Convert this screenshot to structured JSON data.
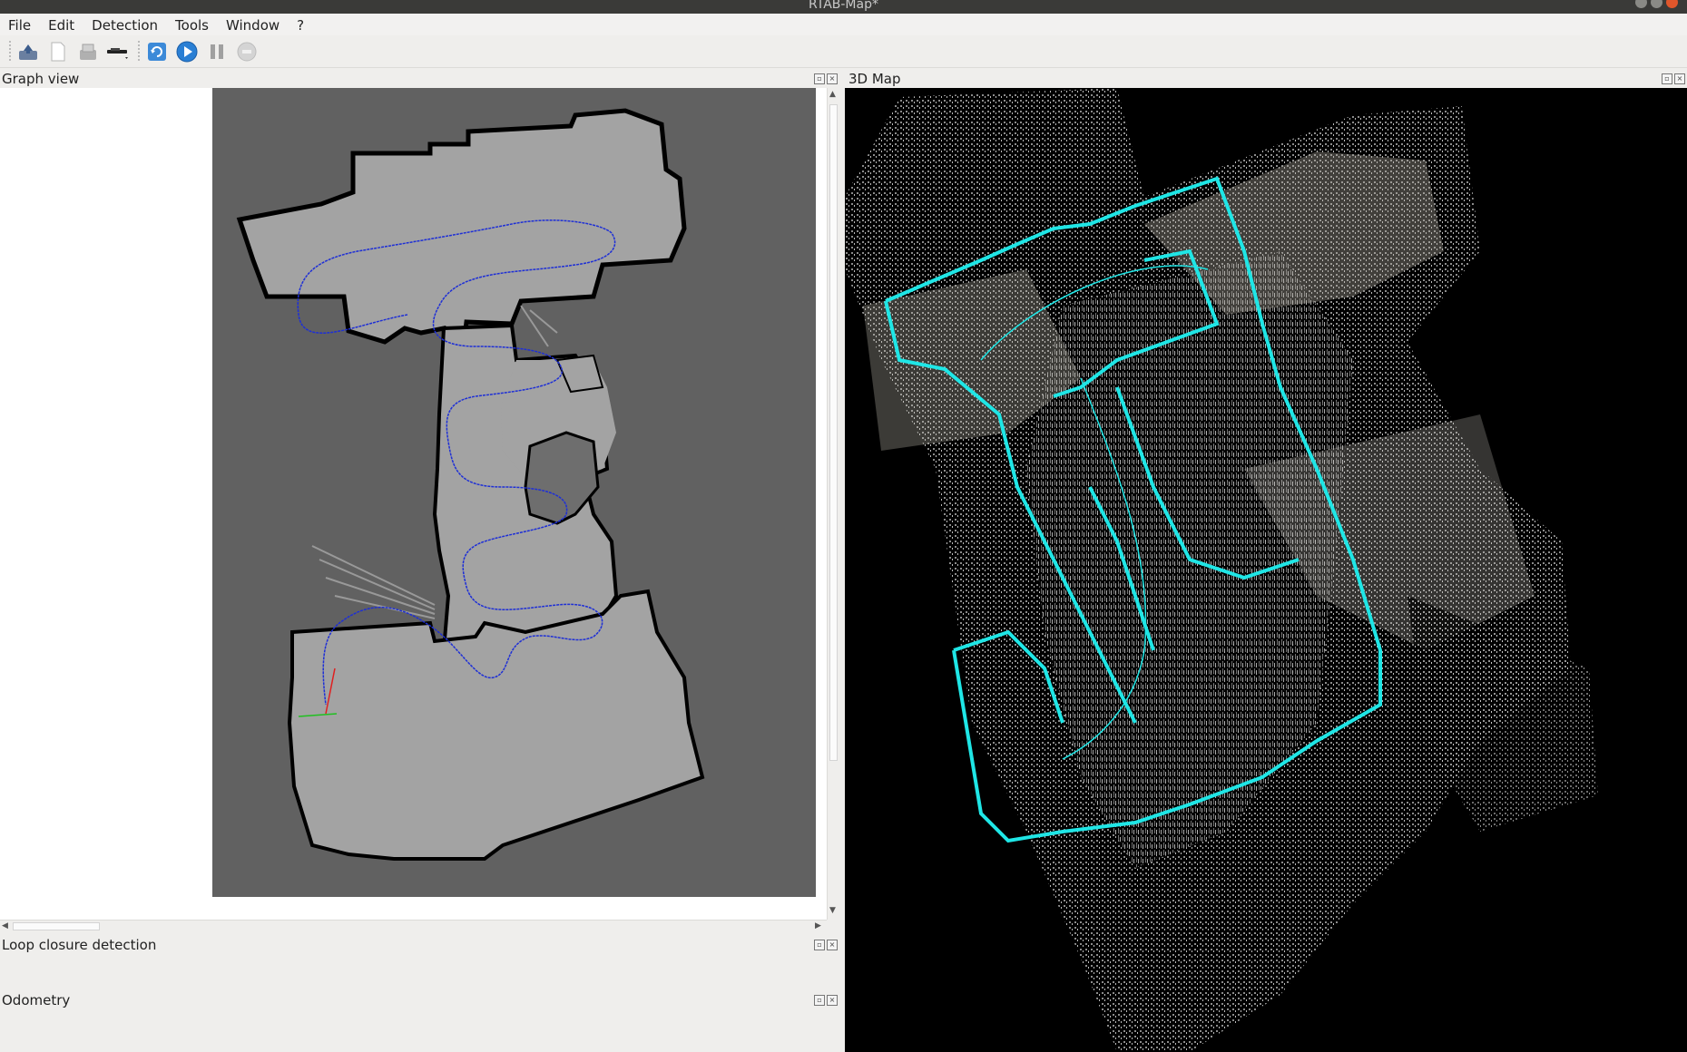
{
  "window": {
    "title": "RTAB-Map*"
  },
  "menubar": {
    "items": [
      {
        "name": "menu-file",
        "label": "File"
      },
      {
        "name": "menu-edit",
        "label": "Edit"
      },
      {
        "name": "menu-detection",
        "label": "Detection"
      },
      {
        "name": "menu-tools",
        "label": "Tools"
      },
      {
        "name": "menu-window",
        "label": "Window"
      },
      {
        "name": "menu-help",
        "label": "?"
      }
    ]
  },
  "toolbar": {
    "buttons": [
      {
        "name": "open-database-button",
        "icon": "open-database-icon"
      },
      {
        "name": "new-database-button",
        "icon": "new-document-icon"
      },
      {
        "name": "close-database-button",
        "icon": "close-database-icon"
      },
      {
        "name": "camera-source-button",
        "icon": "camera-source-icon"
      },
      {
        "name": "trigger-new-map-button",
        "icon": "refresh-icon"
      },
      {
        "name": "start-button",
        "icon": "play-icon"
      },
      {
        "name": "pause-button",
        "icon": "pause-icon"
      },
      {
        "name": "stop-button",
        "icon": "stop-icon"
      }
    ]
  },
  "docks": {
    "graph_view": {
      "title": "Graph view"
    },
    "map_3d": {
      "title": "3D Map"
    },
    "loop_closure": {
      "title": "Loop closure detection"
    },
    "odometry": {
      "title": "Odometry"
    }
  },
  "colors": {
    "occupancy_free": "#a3a3a3",
    "occupancy_unknown": "#616161",
    "occupancy_obstacle": "#000000",
    "trajectory": "#1e2fd6",
    "map_trajectory": "#1fe6e6",
    "map_background": "#000000"
  }
}
